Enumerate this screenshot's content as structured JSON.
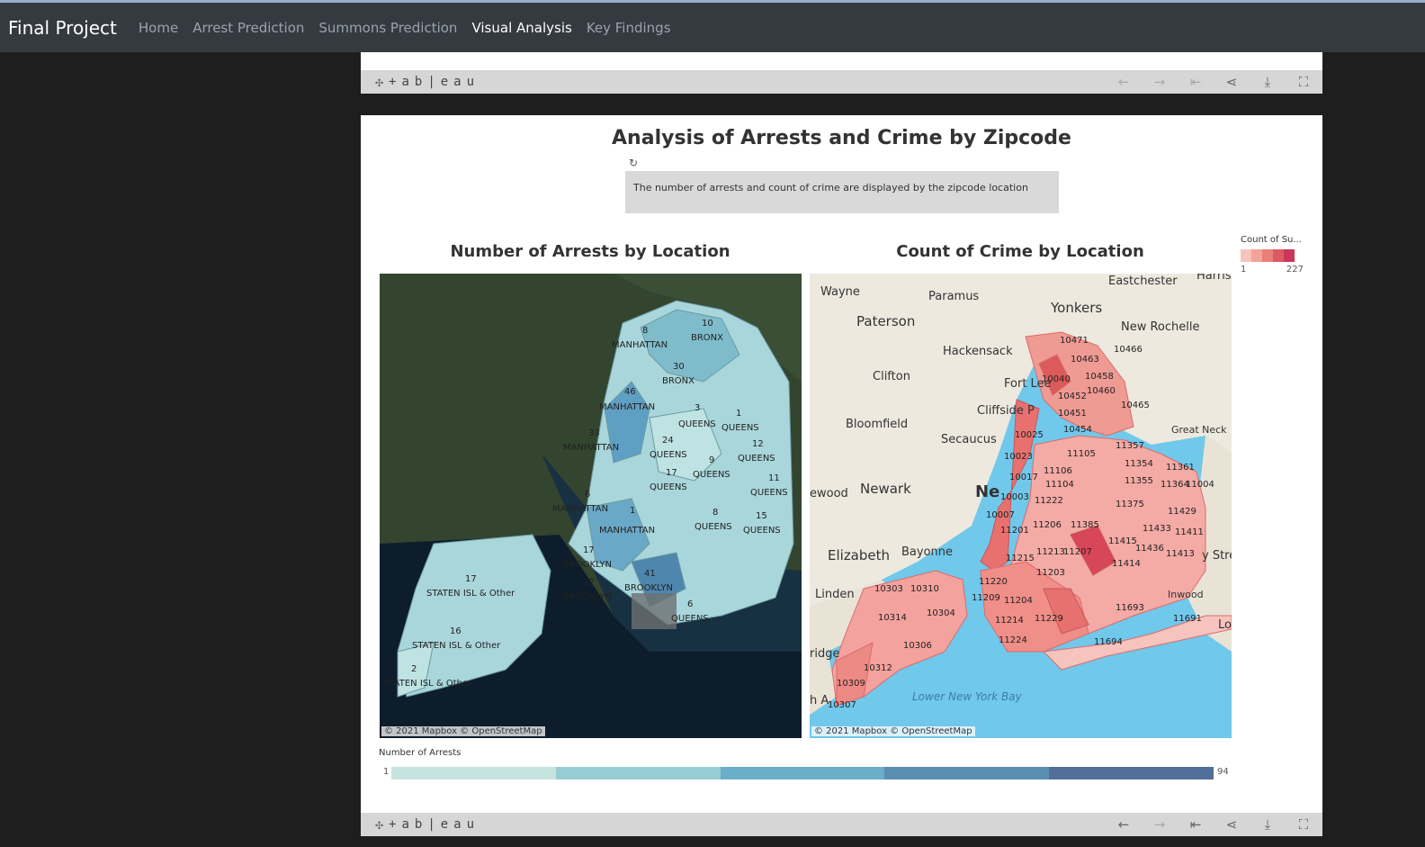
{
  "nav": {
    "brand": "Final Project",
    "links": [
      "Home",
      "Arrest Prediction",
      "Summons Prediction",
      "Visual Analysis",
      "Key Findings"
    ]
  },
  "tableau": {
    "logo_text": "+ab|eau"
  },
  "dashboard": {
    "title": "Analysis of Arrests and Crime by Zipcode",
    "description": "The number of arrests and count of crime are displayed by the zipcode location",
    "left_map_title": "Number of Arrests by Location",
    "right_map_title": "Count of Crime by Location",
    "map_credit": "© 2021 Mapbox  © OpenStreetMap",
    "right_legend": {
      "title": "Count of Su...",
      "min": "1",
      "max": "227",
      "colors": [
        "#f6c3bd",
        "#f2a39a",
        "#ea7e78",
        "#dc5a66",
        "#c9375a"
      ]
    },
    "bottom_legend": {
      "title": "Number of  Arrests",
      "min": "1",
      "max": "94",
      "colors": [
        "#c7e3df",
        "#98ccd4",
        "#6aaec9",
        "#5b8fb2",
        "#516f98"
      ]
    }
  },
  "left_map_labels": [
    "8",
    "MANHATTAN",
    "10",
    "BRONX",
    "30",
    "BRONX",
    "46",
    "MANHATTAN",
    "3",
    "QUEENS",
    "1",
    "QUEENS",
    "33",
    "MANHATTAN",
    "24",
    "QUEENS",
    "12",
    "QUEENS",
    "9",
    "QUEENS",
    "17",
    "QUEENS",
    "11",
    "QUEENS",
    "6",
    "MANHATTAN",
    "1",
    "MANHATTAN",
    "8",
    "QUEENS",
    "15",
    "QUEENS",
    "17",
    "BROOKLYN",
    "22",
    "BROOKLYN",
    "41",
    "BROOKLYN",
    "17",
    "STATEN ISL & Other",
    "6",
    "QUEENS",
    "16",
    "STATEN ISL & Other",
    "2",
    "STATEN ISL & Other"
  ],
  "right_map_places": [
    "Wayne",
    "Paramus",
    "Eastchester",
    "Harrison",
    "Paterson",
    "Yonkers",
    "New Rochelle",
    "Hackensack",
    "Clifton",
    "Fort Lee",
    "Cliffside P",
    "Great Neck",
    "Bloomfield",
    "Secaucus",
    "Newark",
    "Ne",
    "ewood",
    "Elizabeth",
    "Bayonne",
    "Linden",
    "Inwood",
    "Lower New York Bay",
    "ridge",
    "h A",
    "y Stre",
    "Lor"
  ],
  "right_map_zips": [
    "10471",
    "10466",
    "10463",
    "10458",
    "10040",
    "10460",
    "10452",
    "10465",
    "10451",
    "10454",
    "10025",
    "11105",
    "11357",
    "10023",
    "11354",
    "11361",
    "10017",
    "11106",
    "11355",
    "10003",
    "11222",
    "11104",
    "11364",
    "11004",
    "11375",
    "11429",
    "10007",
    "11206",
    "11385",
    "11433",
    "11411",
    "11201",
    "11415",
    "11436",
    "11413",
    "11215",
    "11213",
    "11207",
    "11414",
    "11203",
    "11220",
    "10303",
    "10310",
    "11209",
    "11204",
    "10314",
    "10304",
    "11693",
    "11691",
    "11214",
    "11229",
    "10306",
    "11224",
    "11694",
    "10312",
    "10309",
    "10307"
  ]
}
